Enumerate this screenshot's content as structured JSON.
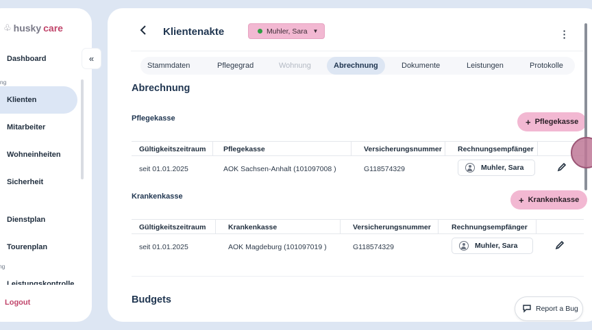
{
  "brand": {
    "part1": "husky",
    "part2": "care"
  },
  "sidebar": {
    "items": [
      {
        "label": "Dashboard"
      },
      {
        "label": "Klienten"
      },
      {
        "label": "Mitarbeiter"
      },
      {
        "label": "Wohneinheiten"
      },
      {
        "label": "Sicherheit"
      },
      {
        "label": "Dienstplan"
      },
      {
        "label": "Tourenplan"
      },
      {
        "label": "Leistungskontrolle"
      }
    ],
    "sections": [
      "waltung",
      "nung",
      "assung"
    ],
    "logout": "Logout",
    "collapse_icon": "«"
  },
  "header": {
    "title": "Klientenakte",
    "client": "Muhler, Sara",
    "client_status_color": "#2f9e44"
  },
  "tabs": [
    {
      "label": "Stammdaten",
      "state": "normal"
    },
    {
      "label": "Pflegegrad",
      "state": "normal"
    },
    {
      "label": "Wohnung",
      "state": "disabled"
    },
    {
      "label": "Abrechnung",
      "state": "active"
    },
    {
      "label": "Dokumente",
      "state": "normal"
    },
    {
      "label": "Leistungen",
      "state": "normal"
    },
    {
      "label": "Protokolle",
      "state": "normal"
    }
  ],
  "section_title": "Abrechnung",
  "pflegekasse": {
    "heading": "Pflegekasse",
    "add_label": "Pflegekasse",
    "columns": [
      "Gültigkeitszeitraum",
      "Pflegekasse",
      "Versicherungsnummer",
      "Rechnungsempfänger"
    ],
    "row": {
      "period": "seit 01.01.2025",
      "kasse": "AOK Sachsen-Anhalt (101097008 )",
      "number": "G118574329",
      "recipient": "Muhler, Sara"
    }
  },
  "krankenkasse": {
    "heading": "Krankenkasse",
    "add_label": "Krankenkasse",
    "columns": [
      "Gültigkeitszeitraum",
      "Krankenkasse",
      "Versicherungsnummer",
      "Rechnungsempfänger"
    ],
    "row": {
      "period": "seit 01.01.2025",
      "kasse": "AOK Magdeburg (101097019 )",
      "number": "G118574329",
      "recipient": "Muhler, Sara"
    }
  },
  "budgets_title": "Budgets",
  "report_bug": "Report a Bug",
  "colors": {
    "accent_pink": "#f2b8d2",
    "brand_pink": "#c0446a",
    "active_bg": "#dde6f3"
  }
}
